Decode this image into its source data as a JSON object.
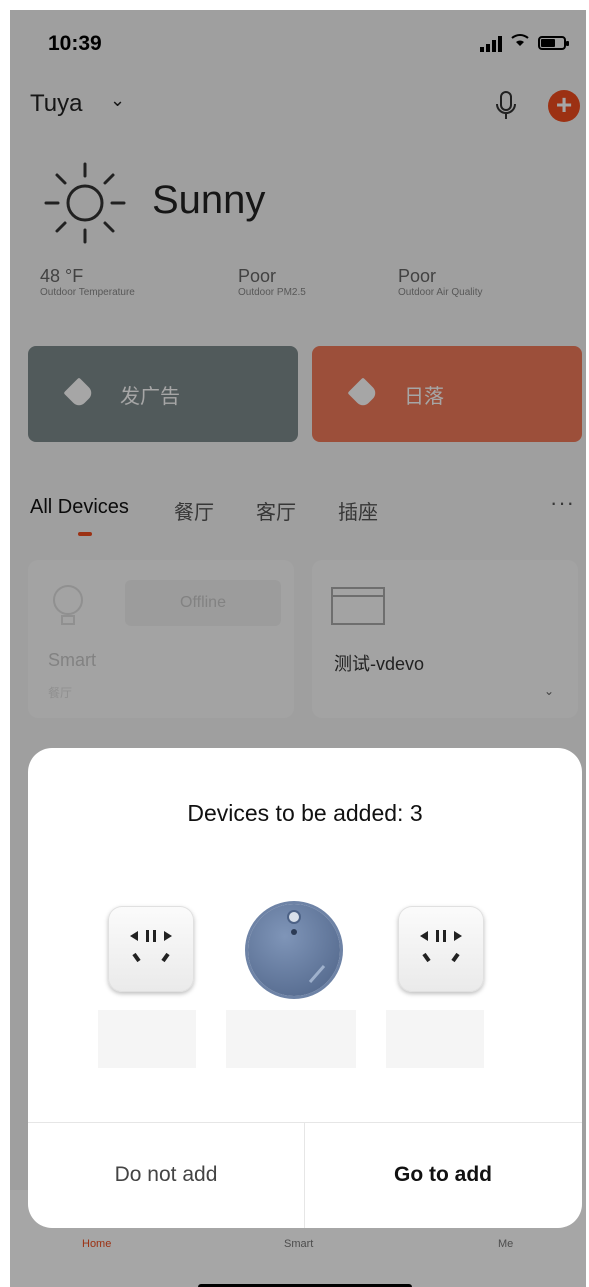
{
  "status_bar": {
    "time": "10:39"
  },
  "header": {
    "home_name": "Tuya",
    "home_chevron": "⌄"
  },
  "weather": {
    "condition": "Sunny",
    "stats": [
      {
        "value": "48 °F",
        "label": "Outdoor Temperature"
      },
      {
        "value": "Poor",
        "label": "Outdoor PM2.5"
      },
      {
        "value": "Poor",
        "label": "Outdoor Air Quality"
      }
    ]
  },
  "banners": [
    {
      "label": "发广告",
      "color": "#7d8a8c"
    },
    {
      "label": "日落",
      "color": "#f07a5a"
    }
  ],
  "tabs": [
    {
      "label": "All Devices",
      "active": true
    },
    {
      "label": "餐厅",
      "active": false
    },
    {
      "label": "客厅",
      "active": false
    },
    {
      "label": "插座",
      "active": false
    }
  ],
  "more_label": "···",
  "devices": [
    {
      "name": "Smart",
      "room": "餐厅",
      "status": "Offline"
    },
    {
      "name": "测试-vdevo",
      "chevron": "⌄"
    }
  ],
  "bottom_nav": [
    {
      "label": "Home",
      "active": true
    },
    {
      "label": "Smart",
      "active": false
    },
    {
      "label": "Me",
      "active": false
    }
  ],
  "dialog": {
    "title": "Devices to be added: 3",
    "devices": [
      "plug-icon",
      "robot-vacuum-icon",
      "plug-icon"
    ],
    "cancel_label": "Do not add",
    "confirm_label": "Go to add"
  },
  "colors": {
    "accent": "#f04c1e",
    "banner_grey": "#7d8a8c",
    "banner_orange": "#f07a5a"
  }
}
